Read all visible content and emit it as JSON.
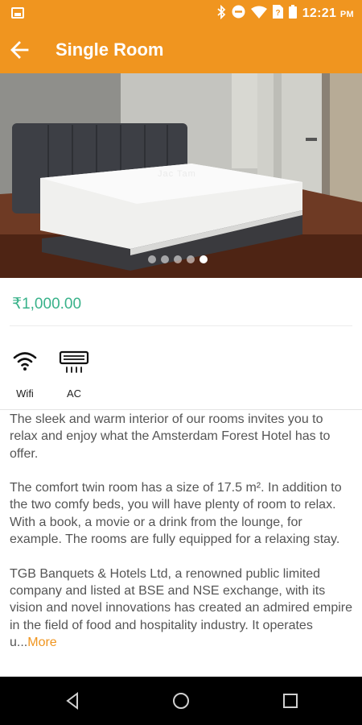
{
  "status_bar": {
    "time": "12:21",
    "ampm": "PM",
    "icons": [
      "image-icon",
      "bluetooth-icon",
      "do-not-disturb-icon",
      "wifi-icon",
      "no-sim-icon",
      "battery-icon"
    ],
    "background": "#f0951f"
  },
  "app_bar": {
    "title": "Single Room",
    "back_icon": "back-arrow-icon",
    "background": "#f0951f"
  },
  "gallery": {
    "watermark": "Jac Tam",
    "page_count": 5,
    "active_index": 4
  },
  "room": {
    "price": "₹1,000.00",
    "price_color": "#39b28a"
  },
  "amenities": [
    {
      "label": "Wifi",
      "icon": "wifi-icon"
    },
    {
      "label": "AC",
      "icon": "air-conditioner-icon"
    }
  ],
  "description": {
    "paragraphs": [
      "The sleek and warm interior of our rooms invites you to relax and enjoy what the Amsterdam Forest Hotel has to offer.",
      "The comfort twin room has a size of 17.5 m². In addition to the two comfy beds, you will have plenty of room to relax. With a book, a movie or a drink from the lounge, for example. The rooms are fully equipped for a relaxing stay.",
      "TGB Banquets & Hotels Ltd, a renowned public limited company and listed at BSE and NSE exchange, with its vision and novel innovations has created an admired empire in the field of food and hospitality industry. It operates u..."
    ],
    "more_label": "More",
    "accent": "#f0951f"
  },
  "nav_bar": {
    "icons": [
      "nav-back-icon",
      "nav-home-icon",
      "nav-recents-icon"
    ]
  }
}
